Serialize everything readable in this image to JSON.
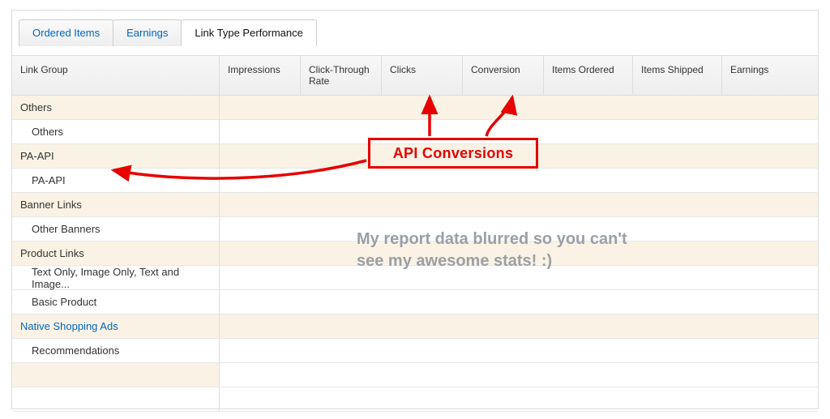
{
  "tabs": {
    "ordered_items": "Ordered Items",
    "earnings": "Earnings",
    "link_type_performance": "Link Type Performance"
  },
  "columns": {
    "link_group": "Link Group",
    "impressions": "Impressions",
    "ctr": "Click-Through Rate",
    "clicks": "Clicks",
    "conversion": "Conversion",
    "items_ordered": "Items Ordered",
    "items_shipped": "Items Shipped",
    "earnings": "Earnings"
  },
  "rows": [
    {
      "type": "group",
      "label": "Others"
    },
    {
      "type": "child",
      "label": "Others"
    },
    {
      "type": "group",
      "label": "PA-API"
    },
    {
      "type": "child",
      "label": "PA-API"
    },
    {
      "type": "group",
      "label": "Banner Links"
    },
    {
      "type": "child",
      "label": "Other Banners"
    },
    {
      "type": "group",
      "label": "Product Links"
    },
    {
      "type": "child",
      "label": "Text Only, Image Only, Text and Image..."
    },
    {
      "type": "child",
      "label": "Basic Product"
    },
    {
      "type": "grouplink",
      "label": "Native Shopping Ads"
    },
    {
      "type": "child",
      "label": "Recommendations"
    },
    {
      "type": "empty",
      "label": ""
    },
    {
      "type": "plain",
      "label": ""
    }
  ],
  "annotation": {
    "box_label": "API Conversions",
    "blurb": "My report data blurred so you can't see my awesome stats! :)"
  }
}
